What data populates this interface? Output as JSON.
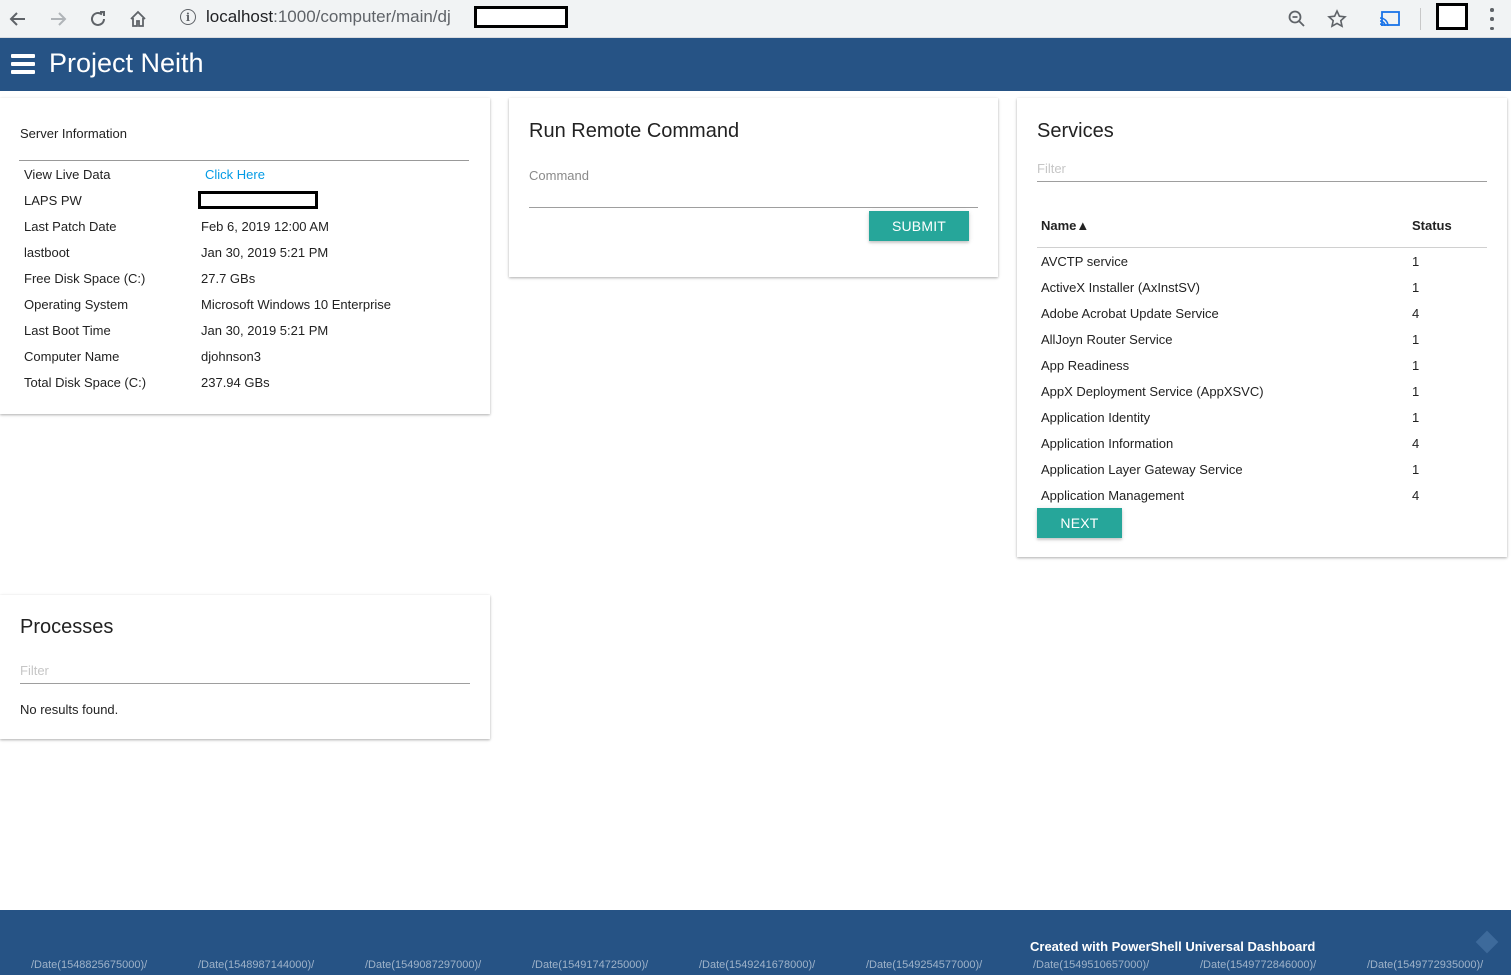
{
  "browser": {
    "url_host": "localhost",
    "url_path": ":1000/computer/main/dj",
    "icons": [
      "back-icon",
      "forward-icon",
      "reload-icon",
      "home-icon",
      "info-icon",
      "zoom-icon",
      "star-icon",
      "cast-icon",
      "extension-icon"
    ]
  },
  "appbar": {
    "title": "Project Neith",
    "color": "#265385"
  },
  "server_info": {
    "caption": "Server Information",
    "rows": [
      {
        "key": "View Live Data",
        "value": "Click Here"
      },
      {
        "key": "LAPS PW",
        "value": ""
      },
      {
        "key": "Last Patch Date",
        "value": "Feb 6, 2019 12:00 AM"
      },
      {
        "key": "lastboot",
        "value": "Jan 30, 2019 5:21 PM"
      },
      {
        "key": "Free Disk Space (C:)",
        "value": "27.7 GBs"
      },
      {
        "key": "Operating System",
        "value": "Microsoft Windows 10 Enterprise"
      },
      {
        "key": "Last Boot Time",
        "value": "Jan 30, 2019 5:21 PM"
      },
      {
        "key": "Computer Name",
        "value": "djohnson3"
      },
      {
        "key": "Total Disk Space (C:)",
        "value": "237.94 GBs"
      }
    ]
  },
  "remote_command": {
    "title": "Run Remote Command",
    "label": "Command",
    "value": "",
    "submit_label": "SUBMIT"
  },
  "services": {
    "title": "Services",
    "filter_placeholder": "Filter",
    "col_name": "Name▲",
    "col_status": "Status",
    "rows": [
      {
        "name": "AVCTP service",
        "status": "1"
      },
      {
        "name": "ActiveX Installer (AxInstSV)",
        "status": "1"
      },
      {
        "name": "Adobe Acrobat Update Service",
        "status": "4"
      },
      {
        "name": "AllJoyn Router Service",
        "status": "1"
      },
      {
        "name": "App Readiness",
        "status": "1"
      },
      {
        "name": "AppX Deployment Service (AppXSVC)",
        "status": "1"
      },
      {
        "name": "Application Identity",
        "status": "1"
      },
      {
        "name": "Application Information",
        "status": "4"
      },
      {
        "name": "Application Layer Gateway Service",
        "status": "1"
      },
      {
        "name": "Application Management",
        "status": "4"
      }
    ],
    "next_label": "NEXT",
    "accent": "#26a69a"
  },
  "processes": {
    "title": "Processes",
    "filter_placeholder": "Filter",
    "empty_text": "No results found."
  },
  "footer": {
    "credit": "Created with PowerShell Universal Dashboard",
    "ghost_dates": [
      "/Date(1548825675000)/",
      "/Date(1548987144000)/",
      "/Date(1549087297000)/",
      "/Date(1549174725000)/",
      "/Date(1549241678000)/",
      "/Date(1549254577000)/",
      "/Date(1549510657000)/",
      "/Date(1549772846000)/",
      "/Date(1549772935000)/"
    ]
  }
}
